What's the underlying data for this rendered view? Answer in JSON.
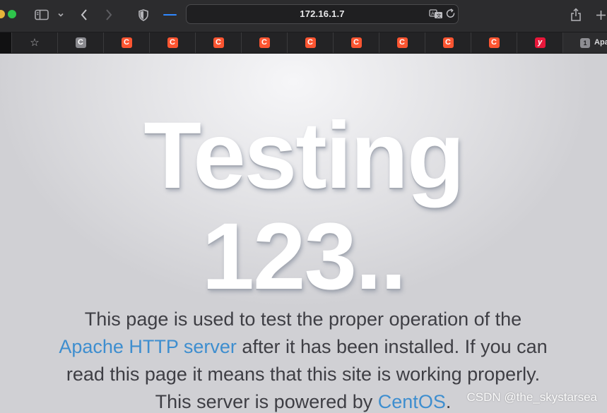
{
  "browser": {
    "address": "172.16.1.7",
    "active_tab": {
      "count_badge": "1",
      "title": "Apache HTTP Server Test Page"
    },
    "favorites": [
      {
        "letter": "C",
        "style": "gray"
      },
      {
        "letter": "C",
        "style": "red"
      },
      {
        "letter": "C",
        "style": "red"
      },
      {
        "letter": "C",
        "style": "red"
      },
      {
        "letter": "C",
        "style": "red"
      },
      {
        "letter": "C",
        "style": "red"
      },
      {
        "letter": "C",
        "style": "red"
      },
      {
        "letter": "C",
        "style": "red"
      },
      {
        "letter": "C",
        "style": "red"
      },
      {
        "letter": "C",
        "style": "red"
      },
      {
        "letter": "y",
        "style": "yd"
      }
    ],
    "colors": {
      "chrome_bg": "#2c2c2e",
      "loading_accent": "#2f88ff",
      "csdn_red": "#fc5531"
    },
    "icons": {
      "sidebar": "sidebar-icon",
      "chevron": "chevron-down-icon",
      "back": "back-arrow-icon",
      "forward": "forward-arrow-icon",
      "shield": "privacy-shield-icon",
      "translate": "translate-icon",
      "reload": "reload-icon",
      "share": "share-icon",
      "new_tab": "plus-icon",
      "favorites": "star-icon"
    }
  },
  "page": {
    "heading_line1": "Testing",
    "heading_line2": "123..",
    "paragraph": {
      "part1": "This page is used to test the proper operation of the ",
      "link1": "Apache HTTP server",
      "part2": " after it has been installed. If you can read this page it means that this site is working properly. This server is powered by ",
      "link2": "CentOS",
      "part3": "."
    },
    "link_color": "#3e8ecf"
  },
  "watermark": "CSDN @the_skystarsea"
}
